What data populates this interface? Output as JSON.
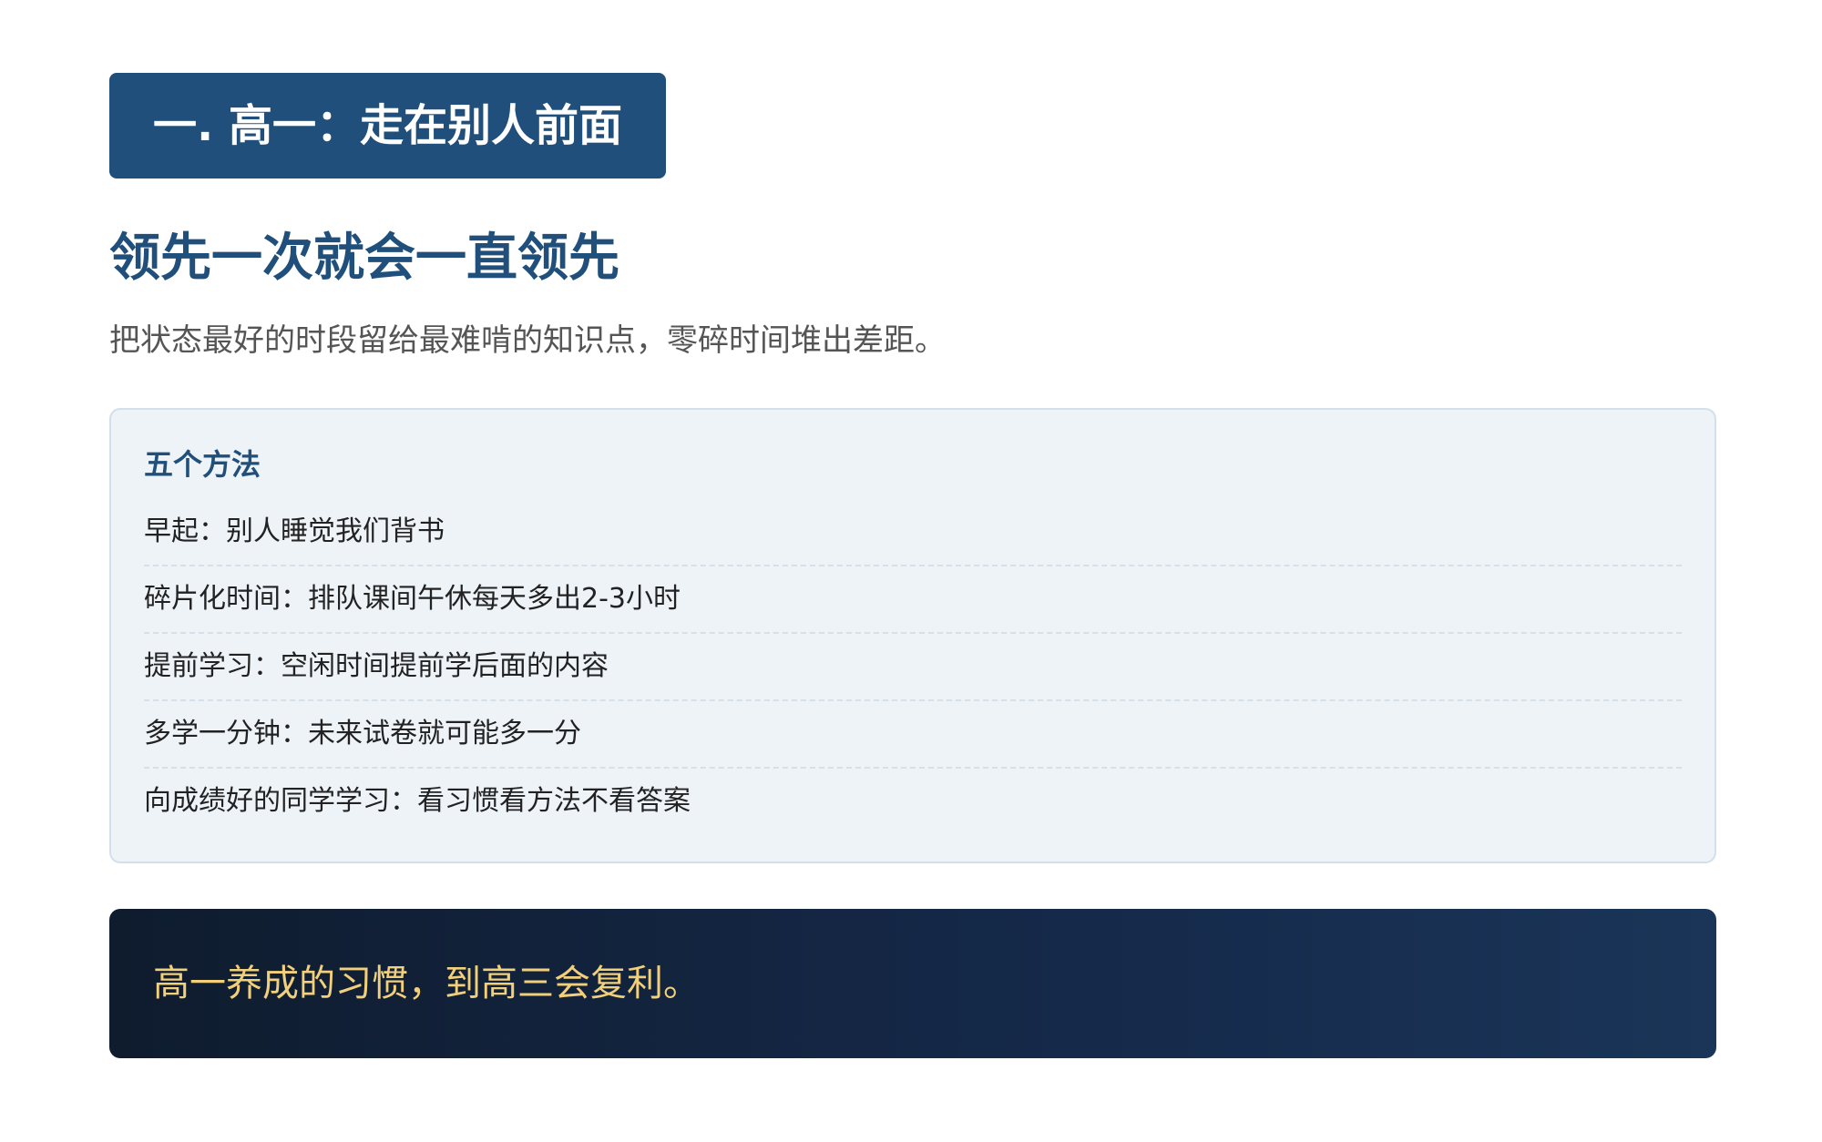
{
  "section_badge": "一. 高一：走在别人前面",
  "main_title": "领先一次就会一直领先",
  "subtitle": "把状态最好的时段留给最难啃的知识点，零碎时间堆出差距。",
  "methods": {
    "title": "五个方法",
    "items": [
      "早起：别人睡觉我们背书",
      "碎片化时间：排队课间午休每天多出2-3小时",
      "提前学习：空闲时间提前学后面的内容",
      "多学一分钟：未来试卷就可能多一分",
      "向成绩好的同学学习：看习惯看方法不看答案"
    ]
  },
  "callout": "高一养成的习惯，到高三会复利。",
  "colors": {
    "accent": "#1f4f7a",
    "card_bg": "#eef3f8",
    "callout_bg": "#15294a",
    "callout_text": "#f2cf7a"
  }
}
